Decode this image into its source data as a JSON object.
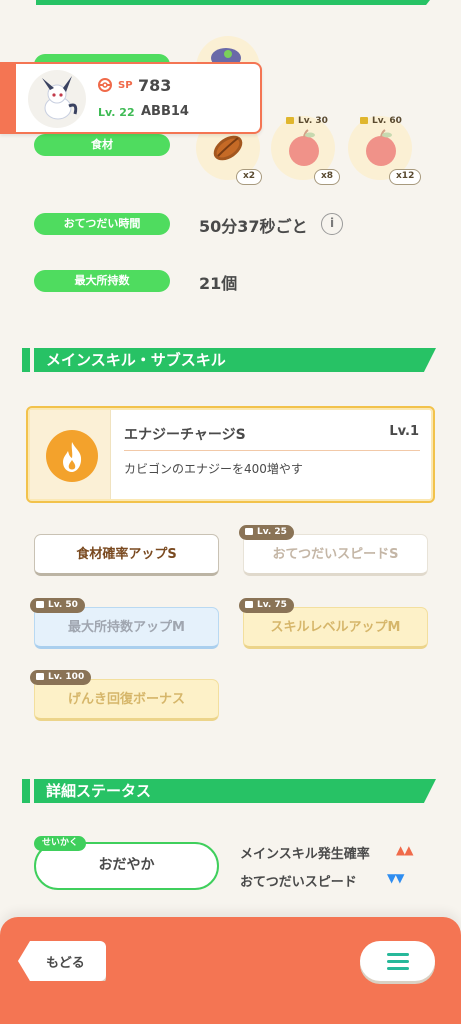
{
  "profile": {
    "sp_label": "SP",
    "sp_value": "783",
    "level": "Lv. 22",
    "code": "ABB14"
  },
  "ingredients": {
    "label": "食材",
    "items": [
      {
        "count": "x2",
        "lock": ""
      },
      {
        "count": "x8",
        "lock": "Lv. 30"
      },
      {
        "count": "x12",
        "lock": "Lv. 60"
      }
    ]
  },
  "help_time": {
    "label": "おてつだい時間",
    "value": "50分37秒ごと",
    "info_icon": "i"
  },
  "max_carry": {
    "label": "最大所持数",
    "value": "21個"
  },
  "skills": {
    "section_title": "メインスキル・サブスキル",
    "main": {
      "name": "エナジーチャージS",
      "level": "Lv.1",
      "description": "カビゴンのエナジーを400増やす"
    },
    "subs": [
      {
        "name": "食材確率アップS",
        "lock": ""
      },
      {
        "name": "おてつだいスピードS",
        "lock": "Lv. 25"
      },
      {
        "name": "最大所持数アップM",
        "lock": "Lv. 50"
      },
      {
        "name": "スキルレベルアップM",
        "lock": "Lv. 75"
      },
      {
        "name": "げんき回復ボーナス",
        "lock": "Lv. 100"
      }
    ]
  },
  "details": {
    "section_title": "詳細ステータス",
    "nature_tag": "せいかく",
    "nature": "おだやか",
    "up_stat": "メインスキル発生確率",
    "up_arrows": "▲▲",
    "down_stat": "おてつだいスピード",
    "down_arrows": "▼▼"
  },
  "footer": {
    "back_label": "もどる"
  },
  "colors": {
    "green": "#27c265",
    "pill": "#4fdc5f",
    "orange": "#f47553",
    "up": "#f06a4a",
    "down": "#2f8df0",
    "gold": "#f2c24b"
  }
}
